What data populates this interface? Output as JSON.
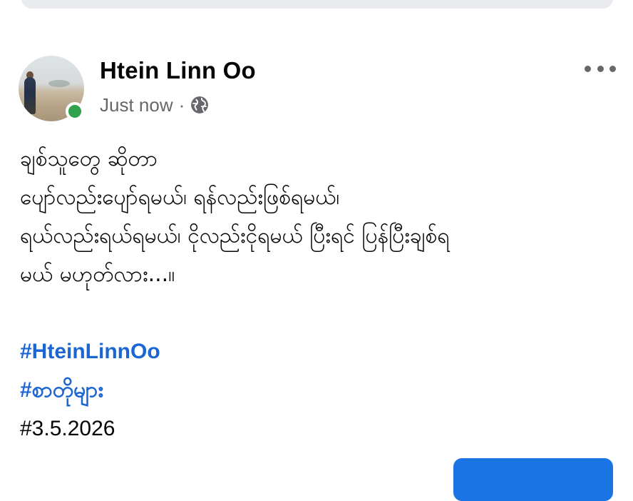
{
  "post": {
    "author": "Htein Linn Oo",
    "time": "Just now",
    "separator": "·",
    "audience_icon": "globe-icon",
    "more_icon": "more-horizontal-icon",
    "lines": [
      "ချစ်သူတွေ ဆိုတာ",
      "ပျော်လည်းပျော်ရမယ်၊ ရန်လည်းဖြစ်ရမယ်၊",
      "ရယ်လည်းရယ်ရမယ်၊ ငိုလည်းငိုရမယ် ပြီးရင် ပြန်ပြီးချစ်ရ",
      "မယ် မဟုတ်လား...။"
    ],
    "hashtags": [
      "#HteinLinnOo",
      "#စာတိုများ"
    ],
    "date_tag": "#3.5.2026"
  },
  "colors": {
    "hashtag": "#1b66d2",
    "online": "#31a24c",
    "meta_text": "#65676b",
    "button": "#1b74e4"
  }
}
